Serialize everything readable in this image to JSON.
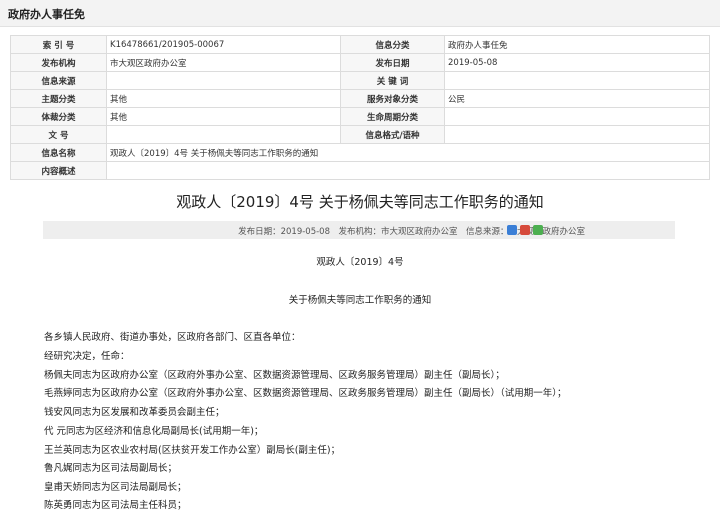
{
  "header": {
    "title": "政府办人事任免"
  },
  "meta": {
    "rows": [
      [
        "索 引 号",
        "K16478661/201905-00067",
        "信息分类",
        "政府办人事任免"
      ],
      [
        "发布机构",
        "市大观区政府办公室",
        "发布日期",
        "2019-05-08"
      ],
      [
        "信息来源",
        "",
        "关 键 词",
        ""
      ],
      [
        "主题分类",
        "其他",
        "服务对象分类",
        "公民"
      ],
      [
        "体裁分类",
        "其他",
        "生命周期分类",
        ""
      ],
      [
        "文 号",
        "",
        "信息格式/语种",
        ""
      ]
    ],
    "name_label": "信息名称",
    "name_value": "观政人〔2019〕4号 关于杨佩夫等同志工作职务的通知",
    "summary_label": "内容概述",
    "summary_value": ""
  },
  "article": {
    "title": "观政人〔2019〕4号 关于杨佩夫等同志工作职务的通知",
    "info": "发布日期：2019-05-08　发布机构：市大观区政府办公室　信息来源：市大观区政府办公室",
    "share_icons": [
      "share-icon-a",
      "share-icon-b",
      "share-icon-c"
    ],
    "share_colors": [
      "#3b7fd6",
      "#d64a3b",
      "#4caf50"
    ],
    "doc_number": "观政人〔2019〕4号",
    "doc_title": "关于杨佩夫等同志工作职务的通知",
    "paragraphs": [
      "各乡镇人民政府、街道办事处，区政府各部门、区直各单位：",
      "经研究决定，任命：",
      "杨佩夫同志为区政府办公室（区政府外事办公室、区数据资源管理局、区政务服务管理局）副主任（副局长）；",
      "毛燕婷同志为区政府办公室（区政府外事办公室、区数据资源管理局、区政务服务管理局）副主任（副局长）（试用期一年）；",
      "钱安风同志为区发展和改革委员会副主任；",
      "代 元同志为区经济和信息化局副局长(试用期一年)；",
      "王兰英同志为区农业农村局(区扶贫开发工作办公室）副局长(副主任)；",
      "鲁凡娓同志为区司法局副局长；",
      "皇甫天娇同志为区司法局副局长；",
      "陈英勇同志为区司法局主任科员；"
    ]
  }
}
